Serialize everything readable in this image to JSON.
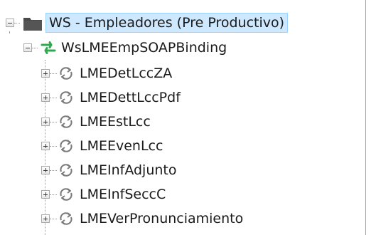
{
  "tree": {
    "root": {
      "label": "WS - Empleadores (Pre Productivo)",
      "icon": "folder-icon",
      "expanded": true,
      "selected": true
    },
    "binding": {
      "label": "WsLMEEmpSOAPBinding",
      "icon": "binding-arrows-icon",
      "expanded": true
    },
    "operations": [
      {
        "label": "LMEDetLccZA",
        "icon": "operation-cycle-icon",
        "expanded": false
      },
      {
        "label": "LMEDettLccPdf",
        "icon": "operation-cycle-icon",
        "expanded": false
      },
      {
        "label": "LMEEstLcc",
        "icon": "operation-cycle-icon",
        "expanded": false
      },
      {
        "label": "LMEEvenLcc",
        "icon": "operation-cycle-icon",
        "expanded": false
      },
      {
        "label": "LMEInfAdjunto",
        "icon": "operation-cycle-icon",
        "expanded": false
      },
      {
        "label": "LMEInfSeccC",
        "icon": "operation-cycle-icon",
        "expanded": false
      },
      {
        "label": "LMEVerPronunciamiento",
        "icon": "operation-cycle-icon",
        "expanded": false
      }
    ]
  },
  "colors": {
    "selection_bg": "#cde8ff",
    "selection_border": "#99d1ff",
    "folder": "#4a4a4a",
    "binding_green": "#2fa84f",
    "operation_gray": "#7a7a7a"
  }
}
